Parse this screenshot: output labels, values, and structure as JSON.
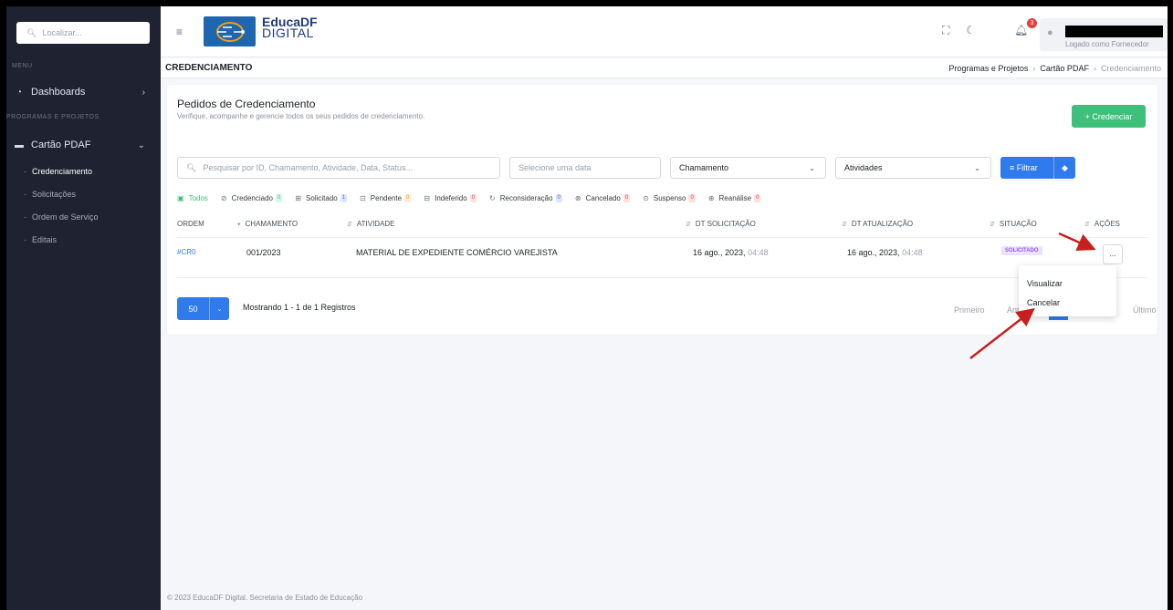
{
  "sidebar": {
    "search_placeholder": "Localizar...",
    "menu_heading": "MENU",
    "dashboards_label": "Dashboards",
    "programs_heading": "PROGRAMAS E PROJETOS",
    "cartao_label": "Cartão PDAF",
    "sub_items": [
      "Credenciamento",
      "Solicitações",
      "Ordem de Serviço",
      "Editais"
    ]
  },
  "topbar": {
    "logo_title": "EducaDF",
    "logo_subtitle": "DIGITAL",
    "notification_count": "3",
    "user_role": "Logado como Fornecedor"
  },
  "crumbbar": {
    "page_title": "CREDENCIAMENTO",
    "breadcrumb": [
      "Programas e Projetos",
      "Cartão PDAF",
      "Credenciamento"
    ]
  },
  "card": {
    "title": "Pedidos de Credenciamento",
    "subtitle": "Verifique, acompanhe e gerencie todos os seus pedidos de credenciamento.",
    "new_button": "+ Credenciar",
    "search_placeholder": "Pesquisar por ID, Chamamento, Atividade, Data, Status...",
    "date_placeholder": "Selecione uma data",
    "chamamento_select": "Chamamento",
    "atividades_select": "Atividades",
    "filter_button": "Filtrar"
  },
  "tabs": [
    {
      "label": "Todos",
      "count": ""
    },
    {
      "label": "Credenciado",
      "count": "0"
    },
    {
      "label": "Solicitado",
      "count": "1"
    },
    {
      "label": "Pendente",
      "count": "0"
    },
    {
      "label": "Indeferido",
      "count": "0"
    },
    {
      "label": "Reconsideração",
      "count": "0"
    },
    {
      "label": "Cancelado",
      "count": "0"
    },
    {
      "label": "Suspenso",
      "count": "0"
    },
    {
      "label": "Reanálise",
      "count": "0"
    }
  ],
  "table": {
    "headers": [
      "ORDEM",
      "CHAMAMENTO",
      "ATIVIDADE",
      "DT SOLICITAÇÃO",
      "DT ATUALIZAÇÃO",
      "SITUAÇÃO",
      "AÇÕES"
    ],
    "row": {
      "order": "#CR0",
      "chamamento": "001/2023",
      "atividade": "MATERIAL DE EXPEDIENTE COMÉRCIO VAREJISTA",
      "dt_solicitacao_date": "16 ago., 2023,",
      "dt_solicitacao_time": "04:48",
      "dt_atualizacao_date": "16 ago., 2023,",
      "dt_atualizacao_time": "04:48",
      "situacao": "SOLICITADO",
      "actions": "..."
    }
  },
  "pagination": {
    "page_size": "50",
    "showing": "Mostrando 1 - 1 de 1 Registros",
    "first": "Primeiro",
    "previous_partial": "Ante",
    "last": "Último"
  },
  "dropdown": {
    "view": "Visualizar",
    "cancel": "Cancelar"
  },
  "footer": "© 2023 EducaDF Digital. Secretaria de Estado de Educação",
  "colors": {
    "sidebar": "#1f2230",
    "primary": "#2f7bed",
    "success": "#3ec07b",
    "annotation_arrow": "#c81e1e"
  }
}
